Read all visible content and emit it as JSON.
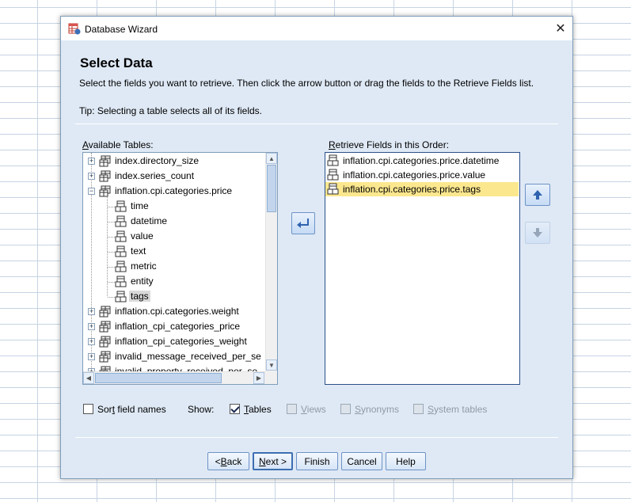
{
  "window": {
    "title": "Database Wizard",
    "close_symbol": "✕"
  },
  "page": {
    "heading": "Select Data",
    "instruction": "Select the fields you want to retrieve. Then click the arrow button or drag the fields to the Retrieve Fields list.",
    "tip": "Tip: Selecting a table selects all of its fields."
  },
  "available": {
    "label_prefix": "",
    "label_access": "A",
    "label_rest": "vailable Tables:",
    "tree": [
      {
        "label": "index.directory_size",
        "level": 0,
        "toggle": "+"
      },
      {
        "label": "index.series_count",
        "level": 0,
        "toggle": "+"
      },
      {
        "label": "inflation.cpi.categories.price",
        "level": 0,
        "toggle": "-"
      },
      {
        "label": "time",
        "level": 1
      },
      {
        "label": "datetime",
        "level": 1
      },
      {
        "label": "value",
        "level": 1
      },
      {
        "label": "text",
        "level": 1
      },
      {
        "label": "metric",
        "level": 1
      },
      {
        "label": "entity",
        "level": 1
      },
      {
        "label": "tags",
        "level": 1,
        "selected": true
      },
      {
        "label": "inflation.cpi.categories.weight",
        "level": 0,
        "toggle": "+"
      },
      {
        "label": "inflation_cpi_categories_price",
        "level": 0,
        "toggle": "+"
      },
      {
        "label": "inflation_cpi_categories_weight",
        "level": 0,
        "toggle": "+"
      },
      {
        "label": "invalid_message_received_per_se",
        "level": 0,
        "toggle": "+"
      },
      {
        "label": "invalid_property_received_per_se",
        "level": 0,
        "toggle": "+"
      }
    ]
  },
  "retrieve": {
    "label_prefix": "",
    "label_access": "R",
    "label_rest": "etrieve Fields in this Order:",
    "fields": [
      {
        "label": "inflation.cpi.categories.price.datetime"
      },
      {
        "label": "inflation.cpi.categories.price.value"
      },
      {
        "label": "inflation.cpi.categories.price.tags",
        "selected": true
      }
    ]
  },
  "options": {
    "sort_label_a": "Sor",
    "sort_label_u": "t",
    "sort_label_b": " field names",
    "sort_checked": false,
    "show_label": "Show:",
    "tables_u": "T",
    "tables_rest": "ables",
    "tables_checked": true,
    "views_u": "V",
    "views_rest": "iews",
    "synonyms_u": "S",
    "synonyms_rest": "ynonyms",
    "system_u": "S",
    "system_rest": "ystem tables"
  },
  "buttons": {
    "back_pre": "< ",
    "back_u": "B",
    "back_rest": "ack",
    "next_u": "N",
    "next_rest": "ext >",
    "finish": "Finish",
    "cancel": "Cancel",
    "help": "Help"
  },
  "colors": {
    "dialog_bg": "#dfe9f5",
    "selection_highlight": "#fbe78e",
    "accent": "#3d6fb2"
  }
}
